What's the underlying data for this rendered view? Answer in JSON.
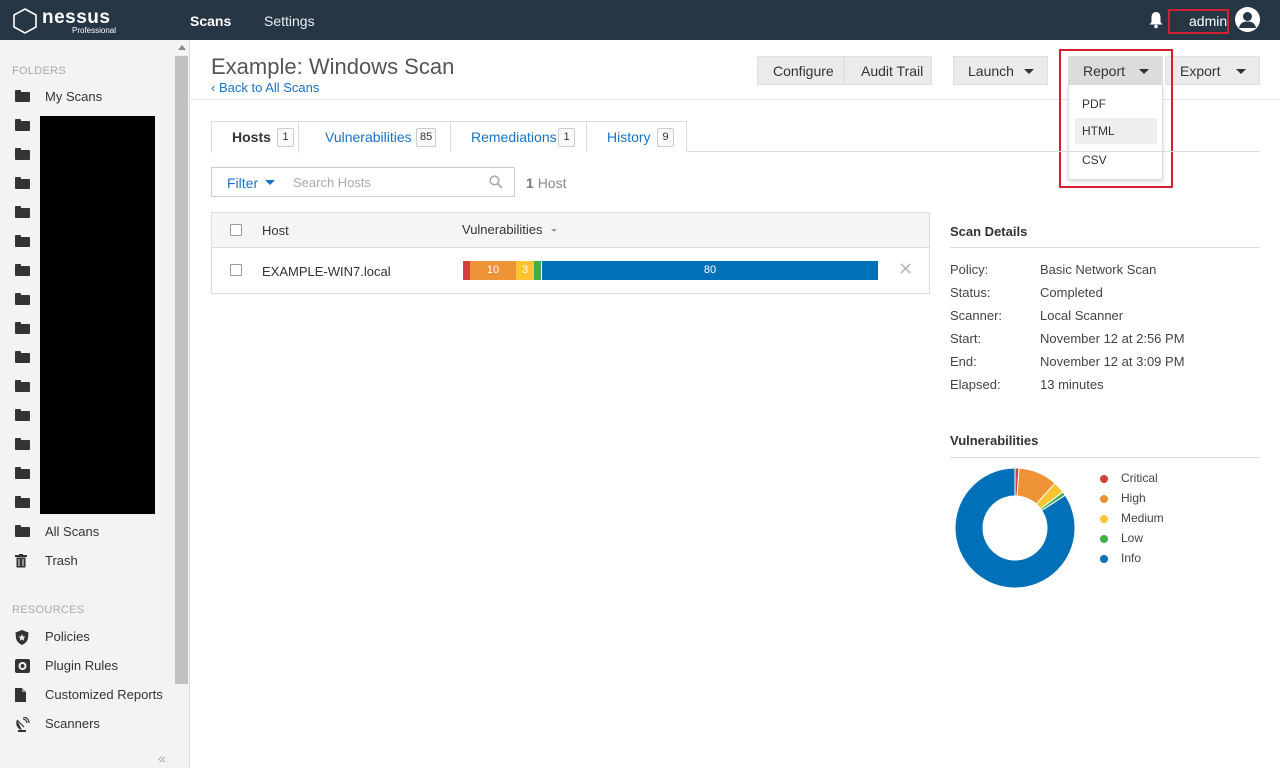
{
  "app": {
    "logo_name": "nessus",
    "logo_sub": "Professional",
    "nav": {
      "scans": "Scans",
      "settings": "Settings"
    },
    "user": "admin"
  },
  "sidebar": {
    "folders_heading": "FOLDERS",
    "my_scans": "My Scans",
    "all_scans": "All Scans",
    "trash": "Trash",
    "resources_heading": "RESOURCES",
    "policies": "Policies",
    "plugin_rules": "Plugin Rules",
    "customized_reports": "Customized Reports",
    "scanners": "Scanners",
    "collapse": "«"
  },
  "header": {
    "title": "Example: Windows Scan",
    "back": "‹ Back to All Scans",
    "buttons": {
      "configure": "Configure",
      "audit_trail": "Audit Trail",
      "launch": "Launch",
      "report": "Report",
      "export": "Export"
    },
    "report_menu": [
      "PDF",
      "HTML",
      "CSV"
    ]
  },
  "tabs": [
    {
      "label": "Hosts",
      "count": "1"
    },
    {
      "label": "Vulnerabilities",
      "count": "85"
    },
    {
      "label": "Remediations",
      "count": "1"
    },
    {
      "label": "History",
      "count": "9"
    }
  ],
  "filter": {
    "label": "Filter",
    "search_placeholder": "Search Hosts",
    "host_count": "1",
    "host_word": "Host"
  },
  "table": {
    "col_host": "Host",
    "col_vulns": "Vulnerabilities",
    "row": {
      "host": "EXAMPLE-WIN7.local",
      "critical": "",
      "high": "10",
      "medium": "3",
      "low": "",
      "info": "80"
    }
  },
  "scan_details": {
    "title": "Scan Details",
    "rows": [
      {
        "k": "Policy:",
        "v": "Basic Network Scan"
      },
      {
        "k": "Status:",
        "v": "Completed"
      },
      {
        "k": "Scanner:",
        "v": "Local Scanner"
      },
      {
        "k": "Start:",
        "v": "November 12 at 2:56 PM"
      },
      {
        "k": "End:",
        "v": "November 12 at 3:09 PM"
      },
      {
        "k": "Elapsed:",
        "v": "13 minutes"
      }
    ]
  },
  "vulnerabilities": {
    "title": "Vulnerabilities",
    "legend": [
      "Critical",
      "High",
      "Medium",
      "Low",
      "Info"
    ],
    "colors": {
      "critical": "#d43f3a",
      "high": "#ee9336",
      "medium": "#fdc431",
      "low": "#3fae49",
      "info": "#0071b9"
    }
  },
  "chart_data": {
    "type": "pie",
    "categories": [
      "Critical",
      "High",
      "Medium",
      "Low",
      "Info"
    ],
    "values": [
      1,
      10,
      3,
      1,
      80
    ]
  }
}
